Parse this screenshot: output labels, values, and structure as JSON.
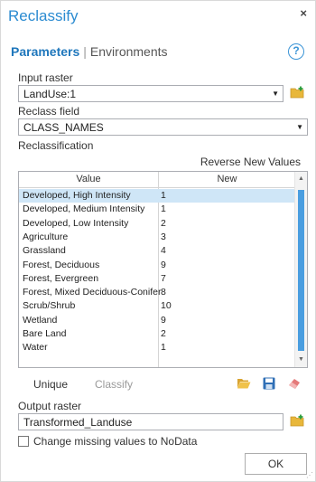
{
  "dialog": {
    "title": "Reclassify",
    "close_glyph": "×"
  },
  "tabs": {
    "active": "Parameters",
    "separator": "|",
    "inactive": "Environments",
    "help_glyph": "?"
  },
  "input_raster": {
    "label": "Input raster",
    "value": "LandUse:1"
  },
  "reclass_field": {
    "label": "Reclass field",
    "value": "CLASS_NAMES"
  },
  "reclassification": {
    "label": "Reclassification",
    "reverse_label": "Reverse New Values",
    "columns": [
      "Value",
      "New"
    ],
    "rows": [
      {
        "value": "Developed, High Intensity",
        "new": "1",
        "selected": true
      },
      {
        "value": "Developed, Medium Intensity",
        "new": "1",
        "selected": false
      },
      {
        "value": "Developed, Low Intensity",
        "new": "2",
        "selected": false
      },
      {
        "value": "Agriculture",
        "new": "3",
        "selected": false
      },
      {
        "value": "Grassland",
        "new": "4",
        "selected": false
      },
      {
        "value": "Forest, Deciduous",
        "new": "9",
        "selected": false
      },
      {
        "value": "Forest, Evergreen",
        "new": "7",
        "selected": false
      },
      {
        "value": "Forest, Mixed Deciduous-Conifer",
        "new": "8",
        "selected": false
      },
      {
        "value": "Scrub/Shrub",
        "new": "10",
        "selected": false
      },
      {
        "value": "Wetland",
        "new": "9",
        "selected": false
      },
      {
        "value": "Bare Land",
        "new": "2",
        "selected": false
      },
      {
        "value": "Water",
        "new": "1",
        "selected": false
      },
      {
        "value": "",
        "new": "",
        "selected": false
      }
    ]
  },
  "tools": {
    "unique_label": "Unique",
    "classify_label": "Classify"
  },
  "output_raster": {
    "label": "Output raster",
    "value": "Transformed_Landuse"
  },
  "missing_values": {
    "label": "Change missing values to NoData",
    "checked": false
  },
  "ok_label": "OK",
  "colors": {
    "accent": "#2b8bd1",
    "selection": "#cfe6f7",
    "scroll_thumb": "#4a9ee0",
    "folder": "#e8b73a",
    "save": "#2f6fb6",
    "eraser": "#e57a7a"
  },
  "icons": [
    "close-icon",
    "help-icon",
    "dropdown-arrow-icon",
    "folder-add-icon",
    "folder-open-icon",
    "save-icon",
    "eraser-icon"
  ]
}
